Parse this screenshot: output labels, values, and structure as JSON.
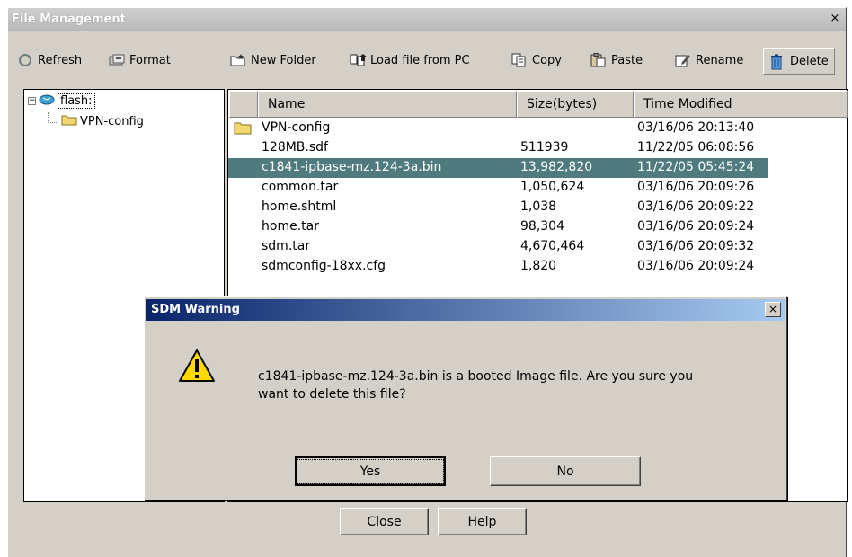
{
  "window": {
    "title": "File Management",
    "close_glyph": "×"
  },
  "toolbar": {
    "refresh": "Refresh",
    "format": "Format",
    "new_folder": "New Folder",
    "load_file": "Load file from PC",
    "copy": "Copy",
    "paste": "Paste",
    "rename": "Rename",
    "delete": "Delete"
  },
  "tree": {
    "root": "flash:",
    "child": "VPN-config"
  },
  "list": {
    "columns": [
      "Name",
      "Size(bytes)",
      "Time Modified"
    ],
    "rows": [
      {
        "name": "VPN-config",
        "size": "",
        "time": "03/16/06 20:13:40",
        "icon": "folder-icon"
      },
      {
        "name": "128MB.sdf",
        "size": "511939",
        "time": "11/22/05 06:08:56"
      },
      {
        "name": "c1841-ipbase-mz.124-3a.bin",
        "size": "13,982,820",
        "time": "11/22/05 05:45:24",
        "selected": true
      },
      {
        "name": "common.tar",
        "size": "1,050,624",
        "time": "03/16/06 20:09:26"
      },
      {
        "name": "home.shtml",
        "size": "1,038",
        "time": "03/16/06 20:09:22"
      },
      {
        "name": "home.tar",
        "size": "98,304",
        "time": "03/16/06 20:09:24"
      },
      {
        "name": "sdm.tar",
        "size": "4,670,464",
        "time": "03/16/06 20:09:32"
      },
      {
        "name": "sdmconfig-18xx.cfg",
        "size": "1,820",
        "time": "03/16/06 20:09:24"
      }
    ]
  },
  "buttons": {
    "close": "Close",
    "help": "Help"
  },
  "dialog": {
    "title": "SDM Warning",
    "close_glyph": "×",
    "message_line1": "c1841-ipbase-mz.124-3a.bin is a booted Image file. Are you sure you",
    "message_line2": "want to delete this file?",
    "yes": "Yes",
    "no": "No",
    "icon": "warning-icon"
  },
  "colors": {
    "selection": "#4f7b7e",
    "dialog_title_start": "#0a246a",
    "dialog_title_end": "#a6caf0",
    "face": "#d4d0c8"
  }
}
